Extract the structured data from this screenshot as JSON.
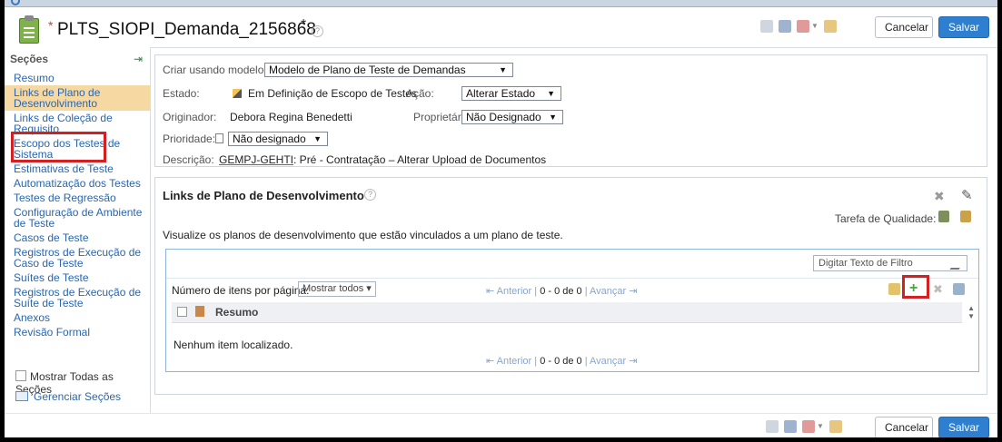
{
  "window": {
    "title": "PLTS_SIOPI_Demanda_2156868",
    "modified_marker": "*",
    "dirty_mark": "*"
  },
  "header": {
    "cancel_label": "Cancelar",
    "save_label": "Salvar"
  },
  "sidebar": {
    "heading": "Seções",
    "items": [
      {
        "label": "Resumo"
      },
      {
        "label": "Links de Plano de Desenvolvimento",
        "active": true
      },
      {
        "label": "Links de Coleção de Requisito"
      },
      {
        "label": "Escopo dos Testes de Sistema"
      },
      {
        "label": "Estimativas de Teste"
      },
      {
        "label": "Automatização dos Testes"
      },
      {
        "label": "Testes de Regressão"
      },
      {
        "label": "Configuração de Ambiente de Teste"
      },
      {
        "label": "Casos de Teste"
      },
      {
        "label": "Registros de Execução de Caso de Teste"
      },
      {
        "label": "Suítes de Teste"
      },
      {
        "label": "Registros de Execução de Suíte de Teste"
      },
      {
        "label": "Anexos"
      },
      {
        "label": "Revisão Formal"
      }
    ],
    "show_all_label": "Mostrar Todas as Seções",
    "manage_label": "Gerenciar Seções"
  },
  "properties": {
    "template_label": "Criar usando modelo:",
    "template_value": "Modelo de Plano de Teste de Demandas",
    "state_label": "Estado:",
    "state_value": "Em Definição de Escopo de Testes",
    "action_label": "Ação:",
    "action_value": "Alterar Estado",
    "originator_label": "Originador:",
    "originator_value": "Debora Regina Benedetti",
    "owner_label": "Proprietário:",
    "owner_value": "Não Designado",
    "priority_label": "Prioridade:",
    "priority_value": "Não designado",
    "description_label": "Descrição:",
    "description_link": "GEMPJ-GEHTI",
    "description_rest": ": Pré - Contratação – Alterar Upload de Documentos"
  },
  "panel": {
    "title": "Links de Plano de Desenvolvimento",
    "quality_task_label": "Tarefa de Qualidade:",
    "description": "Visualize os planos de desenvolvimento que estão vinculados a um plano de teste.",
    "filter_placeholder": "Digitar Texto de Filtro",
    "items_per_page_label": "Número de itens por página:",
    "items_per_page_value": "Mostrar todos",
    "pager_prev": "Anterior",
    "pager_range": "0 - 0 de 0",
    "pager_next": "Avançar",
    "column_resumo": "Resumo",
    "empty_message": "Nenhum item localizado."
  },
  "colors": {
    "accent": "#2e7fd0",
    "active_section": "#f6d9a2",
    "highlight_box": "#d42020",
    "link": "#2a66ad"
  },
  "icons": [
    "document-icon",
    "help-icon",
    "pin-icon",
    "pencil-icon",
    "close-icon",
    "edit-icon",
    "add-icon",
    "delete-icon",
    "link-icon",
    "settings-icon"
  ]
}
